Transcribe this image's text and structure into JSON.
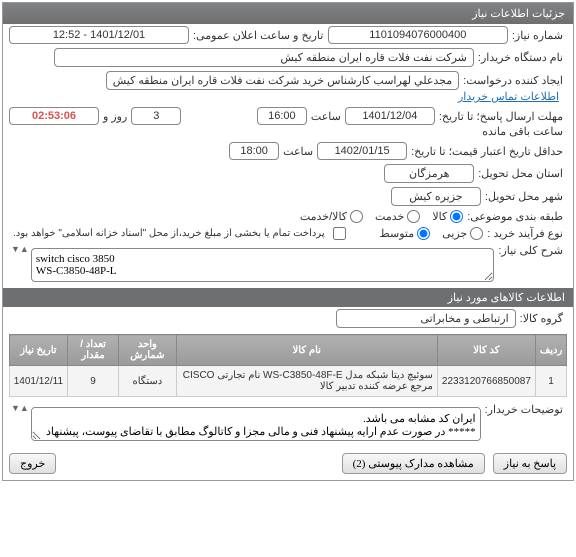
{
  "header": {
    "title": "جزئیات اطلاعات نیاز"
  },
  "labels": {
    "need_no": "شماره نیاز:",
    "announce": "تاریخ و ساعت اعلان عمومی:",
    "buyer_org": "نام دستگاه خریدار:",
    "requester": "ایجاد کننده درخواست:",
    "contact": "اطلاعات تماس خریدار",
    "reply_deadline": "مهلت ارسال پاسخ؛ تا تاریخ:",
    "hour": "ساعت",
    "day_and": "روز و",
    "remain": "ساعت باقی مانده",
    "validity": "حداقل تاریخ اعتبار قیمت؛ تا تاریخ:",
    "province": "استان محل تحویل:",
    "city": "شهر محل تحویل:",
    "category": "طبقه بندی موضوعی:",
    "purchase_type": "نوع فرآیند خرید :",
    "pay_note": "پرداخت تمام یا بخشی از مبلغ خرید،از محل \"اسناد خزانه اسلامی\" خواهد بود.",
    "need_title": "شرح کلی نیاز:",
    "items_hdr": "اطلاعات کالاهای مورد نیاز",
    "group": "گروه کالا:",
    "buyer_notes": "توضیحات خریدار:"
  },
  "values": {
    "need_no": "1101094076000400",
    "announce": "1401/12/01 - 12:52",
    "buyer_org": "شرکت نفت فلات قاره ایران منطقه کیش",
    "requester": "مجدعلي لهراسب کارشناس خرید شرکت نفت فلات قاره ایران منطقه کیش",
    "reply_date": "1401/12/04",
    "reply_hour": "16:00",
    "days_left": "3",
    "countdown": "02:53:06",
    "validity_date": "1402/01/15",
    "validity_hour": "18:00",
    "province": "هرمزگان",
    "city": "جزیره کیش",
    "need_title_text": "switch cisco 3850\nWS-C3850-48P-L",
    "group_val": "ارتباطی و مخابراتی",
    "notes_text": "ایران کد مشابه می باشد.\n***** در صورت عدم ارایه پیشنهاد فنی و مالی مجزا و کاتالوگ مطابق با تقاضای پیوست، پیشنهاد مردود می باشد.******"
  },
  "radios": {
    "cat": {
      "goods": "کالا",
      "service": "خدمت",
      "both": "کالا/خدمت"
    },
    "ptype": {
      "low": "جزیی",
      "mid": "متوسط"
    }
  },
  "table": {
    "cols": {
      "row": "ردیف",
      "code": "کد کالا",
      "name": "نام کالا",
      "unit": "واحد شمارش",
      "qty": "تعداد / مقدار",
      "date": "تاریخ نیاز"
    },
    "rows": [
      {
        "row": "1",
        "code": "2233120766850087",
        "name": "سوئیچ دیتا شبکه مدل WS-C3850-48F-E نام تجارتی CISCO مرجع عرضه کننده تدبیر کالا",
        "unit": "دستگاه",
        "qty": "9",
        "date": "1401/12/11"
      }
    ]
  },
  "buttons": {
    "reply": "پاسخ به نیاز",
    "attach": "مشاهده مدارک پیوستی  (2)",
    "close": "خروج"
  }
}
